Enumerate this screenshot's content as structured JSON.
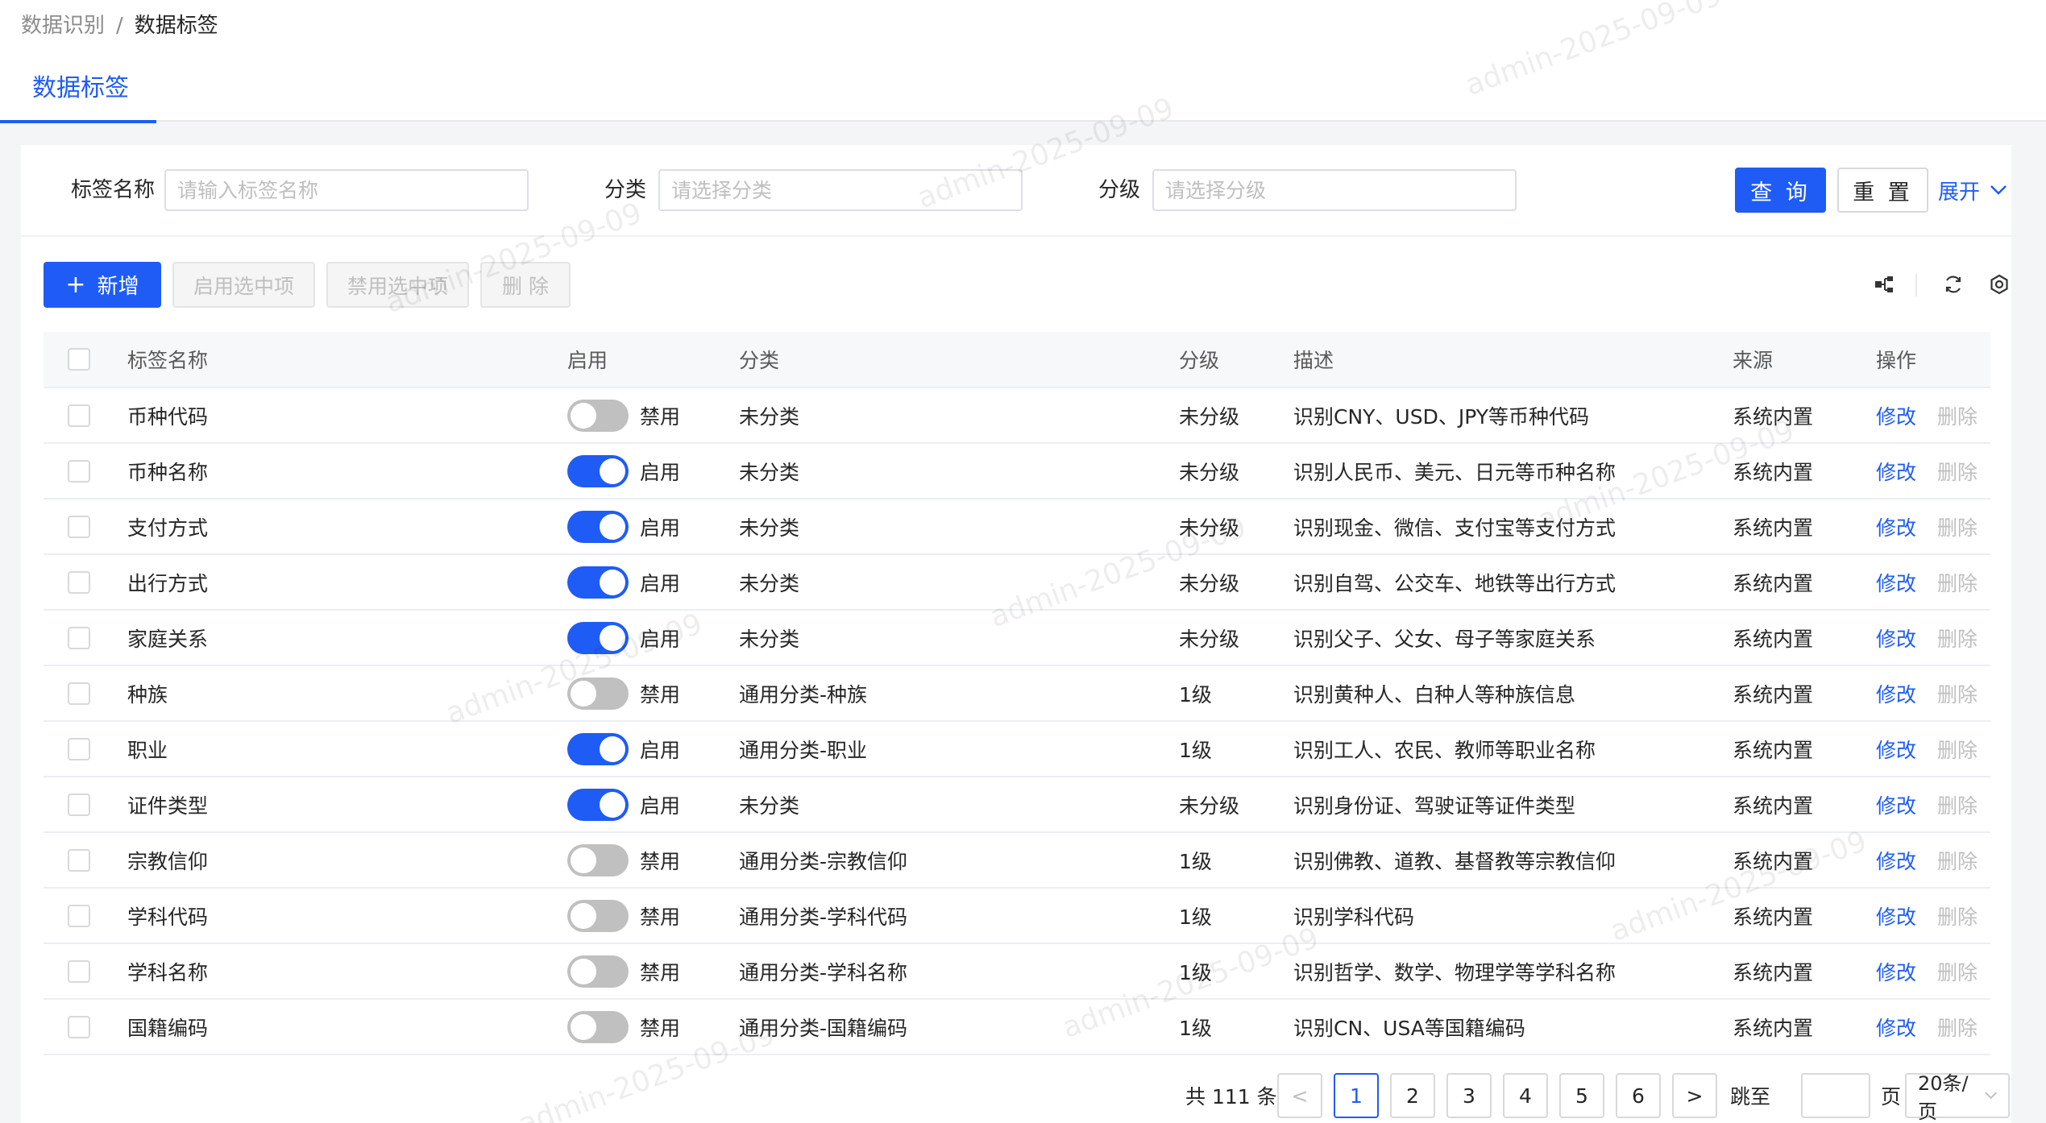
{
  "breadcrumb": [
    "数据识别",
    "数据标签"
  ],
  "breadcrumb_separator": "/",
  "tab": {
    "label": "数据标签"
  },
  "search": {
    "name_label": "标签名称",
    "name_placeholder": "请输入标签名称",
    "category_label": "分类",
    "category_placeholder": "请选择分类",
    "level_label": "分级",
    "level_placeholder": "请选择分级",
    "query_label": "查 询",
    "reset_label": "重 置",
    "expand_label": "展开"
  },
  "toolbar": {
    "add_label": "新增",
    "add_icon": "+",
    "enable_selected_label": "启用选中项",
    "disable_selected_label": "禁用选中项",
    "delete_label": "删 除",
    "icons": [
      "tree-icon",
      "refresh-icon",
      "settings-icon"
    ]
  },
  "table": {
    "headers": [
      "标签名称",
      "启用",
      "分类",
      "分级",
      "描述",
      "来源",
      "操作"
    ],
    "rows": [
      {
        "name": "币种代码",
        "enabled": false,
        "status": "禁用",
        "category": "未分类",
        "level": "未分级",
        "desc": "识别CNY、USD、JPY等币种代码",
        "source": "系统内置",
        "edit": "修改",
        "delete": "删除"
      },
      {
        "name": "币种名称",
        "enabled": true,
        "status": "启用",
        "category": "未分类",
        "level": "未分级",
        "desc": "识别人民币、美元、日元等币种名称",
        "source": "系统内置",
        "edit": "修改",
        "delete": "删除"
      },
      {
        "name": "支付方式",
        "enabled": true,
        "status": "启用",
        "category": "未分类",
        "level": "未分级",
        "desc": "识别现金、微信、支付宝等支付方式",
        "source": "系统内置",
        "edit": "修改",
        "delete": "删除"
      },
      {
        "name": "出行方式",
        "enabled": true,
        "status": "启用",
        "category": "未分类",
        "level": "未分级",
        "desc": "识别自驾、公交车、地铁等出行方式",
        "source": "系统内置",
        "edit": "修改",
        "delete": "删除"
      },
      {
        "name": "家庭关系",
        "enabled": true,
        "status": "启用",
        "category": "未分类",
        "level": "未分级",
        "desc": "识别父子、父女、母子等家庭关系",
        "source": "系统内置",
        "edit": "修改",
        "delete": "删除"
      },
      {
        "name": "种族",
        "enabled": false,
        "status": "禁用",
        "category": "通用分类-种族",
        "level": "1级",
        "desc": "识别黄种人、白种人等种族信息",
        "source": "系统内置",
        "edit": "修改",
        "delete": "删除"
      },
      {
        "name": "职业",
        "enabled": true,
        "status": "启用",
        "category": "通用分类-职业",
        "level": "1级",
        "desc": "识别工人、农民、教师等职业名称",
        "source": "系统内置",
        "edit": "修改",
        "delete": "删除"
      },
      {
        "name": "证件类型",
        "enabled": true,
        "status": "启用",
        "category": "未分类",
        "level": "未分级",
        "desc": "识别身份证、驾驶证等证件类型",
        "source": "系统内置",
        "edit": "修改",
        "delete": "删除"
      },
      {
        "name": "宗教信仰",
        "enabled": false,
        "status": "禁用",
        "category": "通用分类-宗教信仰",
        "level": "1级",
        "desc": "识别佛教、道教、基督教等宗教信仰",
        "source": "系统内置",
        "edit": "修改",
        "delete": "删除"
      },
      {
        "name": "学科代码",
        "enabled": false,
        "status": "禁用",
        "category": "通用分类-学科代码",
        "level": "1级",
        "desc": "识别学科代码",
        "source": "系统内置",
        "edit": "修改",
        "delete": "删除"
      },
      {
        "name": "学科名称",
        "enabled": false,
        "status": "禁用",
        "category": "通用分类-学科名称",
        "level": "1级",
        "desc": "识别哲学、数学、物理学等学科名称",
        "source": "系统内置",
        "edit": "修改",
        "delete": "删除"
      },
      {
        "name": "国籍编码",
        "enabled": false,
        "status": "禁用",
        "category": "通用分类-国籍编码",
        "level": "1级",
        "desc": "识别CN、USA等国籍编码",
        "source": "系统内置",
        "edit": "修改",
        "delete": "删除"
      }
    ]
  },
  "pagination": {
    "total_text": "共 111 条",
    "prev": "<",
    "pages": [
      "1",
      "2",
      "3",
      "4",
      "5",
      "6"
    ],
    "current": "1",
    "next": ">",
    "jump_label": "跳至",
    "page_suffix": "页",
    "page_size": "20条/页"
  },
  "watermark": "admin-2025-09-09",
  "colors": {
    "primary": "#1f5cf5",
    "switch_off": "#c0c0c0",
    "disabled_text": "#bfbfbf"
  }
}
